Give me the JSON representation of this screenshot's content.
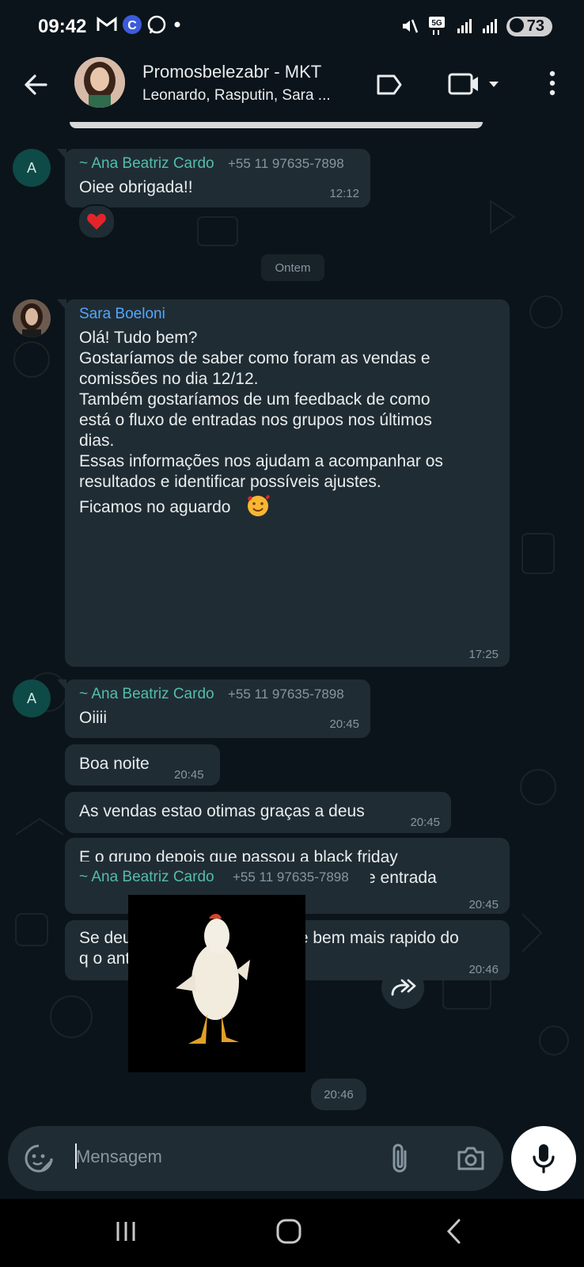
{
  "status_bar": {
    "time": "09:42",
    "battery": "73"
  },
  "header": {
    "title": "Promosbelezabr - MKT",
    "subtitle": "Leonardo, Rasputin, Sara ..."
  },
  "date_separator": "Ontem",
  "messages": [
    {
      "sender": "~ Ana Beatriz Cardo",
      "phone": "+55 11 97635-7898",
      "avatar_letter": "A",
      "text": "Oiee obrigada!!",
      "time": "12:12",
      "reaction": "heart"
    },
    {
      "sender": "Sara Boeloni",
      "lines": [
        "Olá! Tudo bem?",
        "Gostaríamos de saber como foram as vendas e",
        "comissões no dia 12/12.",
        "Também gostaríamos de um feedback de como",
        "está o fluxo de entradas nos grupos nos últimos",
        "dias.",
        "Essas informações nos ajudam a acompanhar os",
        "resultados e identificar possíveis ajustes.",
        "Ficamos no aguardo"
      ],
      "time": "17:25"
    },
    {
      "sender": "~ Ana Beatriz Cardo",
      "phone": "+55 11 97635-7898",
      "avatar_letter": "A",
      "text": "Oiiii",
      "time": "20:45"
    },
    {
      "text": "Boa noite",
      "time": "20:45"
    },
    {
      "text": "As vendas estao otimas graças a deus",
      "time": "20:45"
    },
    {
      "lines": [
        "E o grupo depois que passou a black friday",
        "começou a melhorar bastante o fluxo de entrada"
      ],
      "time": "20:45"
    },
    {
      "lines": [
        "Se deus quiser fecharemos ele bem mais rapido do",
        "q o anterior"
      ],
      "time": "20:46"
    },
    {
      "sender": "~ Ana Beatriz Cardo",
      "phone": "+55 11 97635-7898",
      "type": "sticker",
      "time": "20:46"
    }
  ],
  "composer": {
    "placeholder": "Mensagem"
  },
  "colors": {
    "accent_sender_ana": "#53bdae",
    "accent_sender_sara": "#53a6fd",
    "bubble": "#202c33",
    "background": "#0b141a"
  }
}
